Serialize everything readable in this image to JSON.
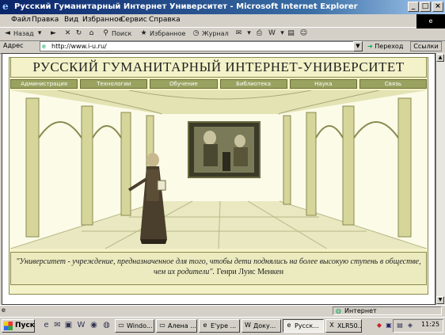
{
  "window": {
    "title": "Русский Гуманитарный Интернет Университет - Microsoft Internet Explorer",
    "minimize": "_",
    "maximize": "□",
    "close": "×"
  },
  "menu": [
    "Файл",
    "Правка",
    "Вид",
    "Избранное",
    "Сервис",
    "Справка"
  ],
  "toolbar": {
    "back": "Назад",
    "search": "Поиск",
    "favorites": "Избранное",
    "history": "Журнал"
  },
  "address": {
    "label": "Адрес",
    "url": "http://www.i-u.ru/",
    "go": "Переход",
    "links": "Ссылки"
  },
  "page": {
    "banner": "РУССКИЙ ГУМАНИТАРНЫЙ ИНТЕРНЕТ-УНИВЕРСИТЕТ",
    "nav": [
      "Администрация",
      "Технологии",
      "Обучение",
      "Библиотека",
      "Наука",
      "Связь"
    ],
    "quote": "\"Университет - учреждение, предназначенное для того, чтобы дети поднялись на более высокую ступень в обществе, чем их родители\".",
    "quote_author": "Генри Луис Менкен"
  },
  "status": {
    "zone": "Интернет"
  },
  "taskbar": {
    "start": "Пуск",
    "tasks": [
      "Windo...",
      "Алена ...",
      "E'ype ...",
      "Доку...",
      "Русск...",
      "XLR50..."
    ],
    "clock": "11:25"
  },
  "colors": {
    "banner_bg": "#f3f2c8",
    "nav_bg": "#9aa260",
    "page_border": "#8a8a50"
  }
}
